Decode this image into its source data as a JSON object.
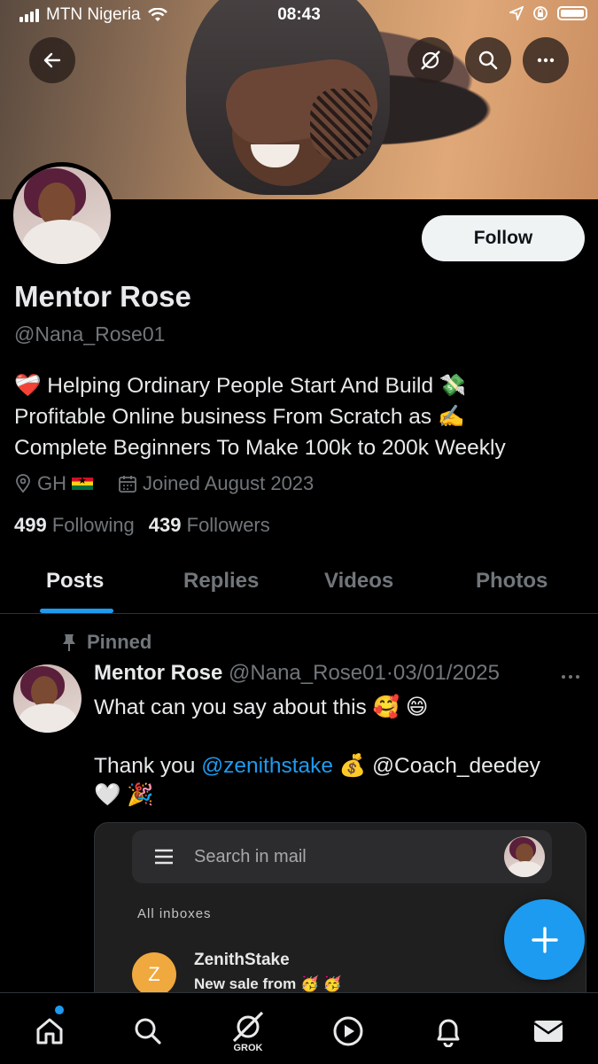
{
  "status_bar": {
    "carrier": "MTN Nigeria",
    "time": "08:43"
  },
  "header_icons": [
    "back-arrow-icon",
    "grok-icon",
    "search-icon",
    "more-icon"
  ],
  "profile": {
    "name": "Mentor Rose",
    "handle": "@Nana_Rose01",
    "bio_lines": [
      "❤️‍🩹 Helping Ordinary People Start And Build 💸",
      "Profitable Online business From Scratch as ✍️",
      "Complete Beginners To Make 100k to 200k Weekly"
    ],
    "location": "GH",
    "joined": "Joined August 2023",
    "following_count": "499",
    "following_label": "Following",
    "followers_count": "439",
    "followers_label": "Followers",
    "follow_button": "Follow"
  },
  "tabs": [
    {
      "label": "Posts",
      "active": true
    },
    {
      "label": "Replies",
      "active": false
    },
    {
      "label": "Videos",
      "active": false
    },
    {
      "label": "Photos",
      "active": false
    }
  ],
  "pinned_post": {
    "pinned_label": "Pinned",
    "author": "Mentor Rose",
    "handle": "@Nana_Rose01",
    "separator": "·",
    "date": "03/01/2025",
    "text_line1": "What can you say about this 🥰 😄",
    "thank_prefix": "Thank you ",
    "mention1": "@zenithstake",
    "money_emoji": " 💰 ",
    "mention2": "@Coach_deedey",
    "text_line3": "🤍 🎉",
    "media": {
      "search_placeholder": "Search in mail",
      "section_label": "All inboxes",
      "sender_initial": "Z",
      "sender": "ZenithStake",
      "subject": "New sale from 🥳 🥳"
    }
  },
  "bottom_nav": {
    "items": [
      "home-icon",
      "search-icon",
      "grok-icon",
      "video-icon",
      "notifications-icon",
      "messages-icon"
    ],
    "grok_label": "GROK"
  },
  "colors": {
    "accent": "#1d9bf0",
    "background": "#000000",
    "secondary_text": "#71767b"
  }
}
